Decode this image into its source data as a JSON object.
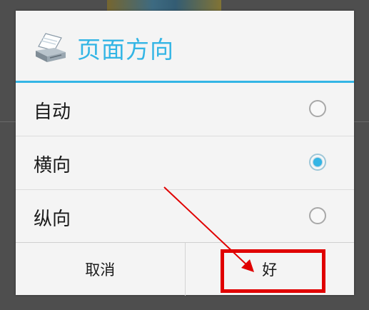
{
  "dialog": {
    "title": "页面方向",
    "icon": "printer-icon",
    "accent_color": "#33b5e5",
    "options": [
      {
        "label": "自动",
        "checked": false
      },
      {
        "label": "横向",
        "checked": true
      },
      {
        "label": "纵向",
        "checked": false
      }
    ],
    "buttons": {
      "cancel_label": "取消",
      "ok_label": "好"
    }
  },
  "annotation": {
    "color": "#e00000",
    "target": "ok-button"
  }
}
